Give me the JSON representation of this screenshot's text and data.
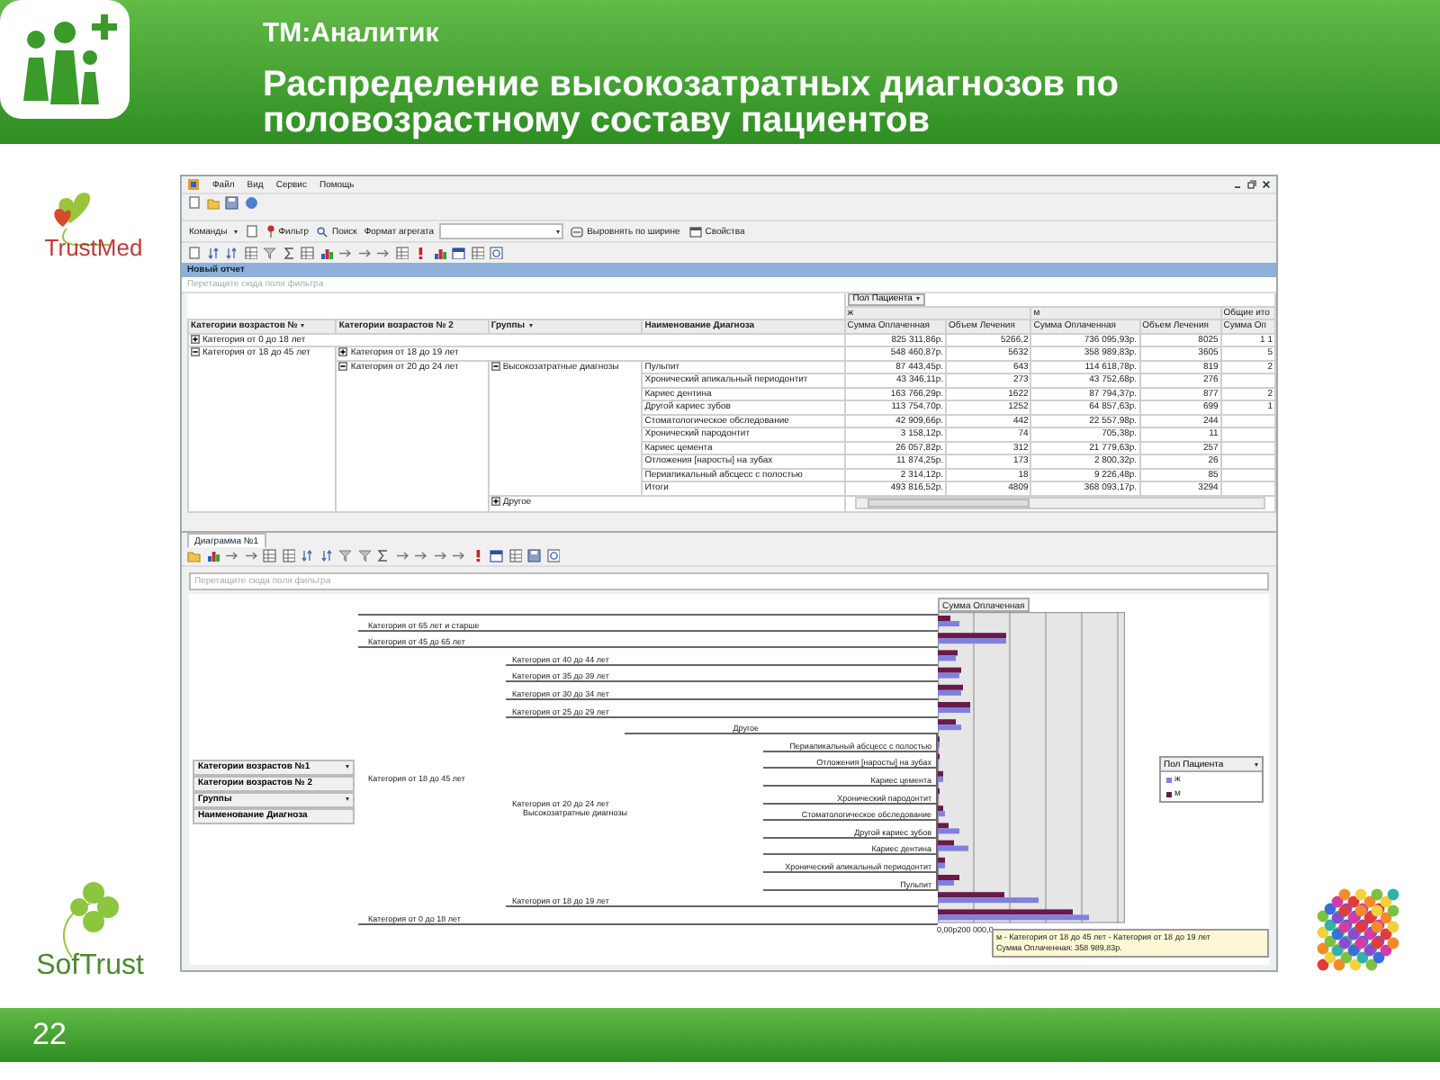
{
  "slide": {
    "subtitle": "ТМ:Аналитик",
    "title": "Распределение высокозатратных диагнозов по половозрастному составу пациентов",
    "page_number": "22"
  },
  "logos": {
    "top_left": "TrustMed",
    "bottom_left": "SofTrust"
  },
  "window": {
    "menu": [
      "Файл",
      "Вид",
      "Сервис",
      "Помощь"
    ],
    "toolbar": {
      "commands": "Команды",
      "filter": "Фильтр",
      "search": "Поиск",
      "aggregate_label": "Формат агрегата",
      "fit_width": "Выровнять по ширине",
      "properties": "Свойства"
    }
  },
  "pivot": {
    "title": "Новый отчет",
    "filter_placeholder": "Перетащите сюда поля фильтра",
    "column_field": "Пол Пациента",
    "column_groups": [
      {
        "label": "ж",
        "measures": [
          "Сумма Оплаченная",
          "Объем Лечения"
        ]
      },
      {
        "label": "м",
        "measures": [
          "Сумма Оплаченная",
          "Объем Лечения"
        ]
      },
      {
        "label": "Общие ито",
        "measures": [
          "Сумма Оп"
        ]
      }
    ],
    "row_fields": [
      {
        "label": "Категории возрастов №",
        "dropdown": true
      },
      {
        "label": "Категории возрастов № 2",
        "dropdown": false
      },
      {
        "label": "Группы",
        "dropdown": true
      },
      {
        "label": "Наименование Диагноза",
        "dropdown": false
      }
    ],
    "rows": [
      {
        "label": "Категория от 0 до 18 лет",
        "expanded": false,
        "values": [
          "825 311,86р.",
          "5266,2",
          "736 095,93р.",
          "8025"
        ],
        "total": "1 1"
      },
      {
        "label": "Категория от 18 до 45 лет",
        "expanded": true,
        "children": [
          {
            "label": "Категория от 18 до 19 лет",
            "expanded": false,
            "values": [
              "548 460,87р.",
              "5632",
              "358 989,83р.",
              "3605"
            ],
            "total": "5"
          },
          {
            "label": "Категория от 20 до 24 лет",
            "expanded": true,
            "children": [
              {
                "label": "Высокозатратные диагнозы",
                "expanded": true,
                "children": [
                  {
                    "label": "Пульпит",
                    "values": [
                      "87 443,45р.",
                      "643",
                      "114 618,78р.",
                      "819"
                    ],
                    "total": "2"
                  },
                  {
                    "label": "Хронический апикальный периодонтит",
                    "values": [
                      "43 346,11р.",
                      "273",
                      "43 752,68р.",
                      "276"
                    ]
                  },
                  {
                    "label": "Кариес дентина",
                    "values": [
                      "163 766,29р.",
                      "1622",
                      "87 794,37р.",
                      "877"
                    ],
                    "total": "2"
                  },
                  {
                    "label": "Другой кариес зубов",
                    "values": [
                      "113 754,70р.",
                      "1252",
                      "64 857,63р.",
                      "699"
                    ],
                    "total": "1"
                  },
                  {
                    "label": "Стоматологическое обследование",
                    "values": [
                      "42 909,66р.",
                      "442",
                      "22 557,98р.",
                      "244"
                    ]
                  },
                  {
                    "label": "Хронический пародонтит",
                    "values": [
                      "3 158,12р.",
                      "74",
                      "705,38р.",
                      "11"
                    ]
                  },
                  {
                    "label": "Кариес цемента",
                    "values": [
                      "26 057,82р.",
                      "312",
                      "21 779,63р.",
                      "257"
                    ]
                  },
                  {
                    "label": "Отложения [наросты] на зубах",
                    "values": [
                      "11 874,25р.",
                      "173",
                      "2 800,32р.",
                      "26"
                    ]
                  },
                  {
                    "label": "Периапикальный абсцесс с полостью",
                    "values": [
                      "2 314,12р.",
                      "18",
                      "9 226,48р.",
                      "85"
                    ]
                  },
                  {
                    "label": "Итоги",
                    "values": [
                      "493 816,52р.",
                      "4809",
                      "368 093,17р.",
                      "3294"
                    ]
                  }
                ]
              },
              {
                "label": "Другое",
                "expanded": false
              }
            ]
          }
        ]
      }
    ]
  },
  "chart": {
    "tab": {
      "label": "Диаграмма №1",
      "selected": true
    },
    "filter_placeholder": "Перетащите сюда поля фильтра",
    "fields": [
      {
        "label": "Категории возрастов №1",
        "dropdown": true
      },
      {
        "label": "Категории возрастов № 2",
        "dropdown": false
      },
      {
        "label": "Группы",
        "dropdown": true
      },
      {
        "label": "Наименование Диагноза",
        "dropdown": false
      }
    ],
    "measure": "Сумма Оплаченная",
    "axis_tree": [
      {
        "label": "Категория от 65 лет и старше"
      },
      {
        "label": "Категория от 45 до 65 лет"
      },
      {
        "label": "Категория от 18 до 45 лет",
        "children": [
          {
            "label": "Категория от 40 до 44 лет"
          },
          {
            "label": "Категория от 35 до 39 лет"
          },
          {
            "label": "Категория от 30 до 34 лет"
          },
          {
            "label": "Категория от 25 до 29 лет"
          },
          {
            "label": "Категория от 20 до 24 лет",
            "children": [
              {
                "label": "Другое"
              },
              {
                "label": "Высокозатратные диагнозы",
                "children": [
                  {
                    "label": "Периапикальный абсцесс с полостью"
                  },
                  {
                    "label": "Отложения [наросты] на зубах"
                  },
                  {
                    "label": "Кариес цемента"
                  },
                  {
                    "label": "Хронический пародонтит"
                  },
                  {
                    "label": "Стоматологическое обследование"
                  },
                  {
                    "label": "Другой кариес зубов"
                  },
                  {
                    "label": "Кариес дентина"
                  },
                  {
                    "label": "Хронический апикальный периодонтит"
                  },
                  {
                    "label": "Пульпит"
                  }
                ]
              }
            ]
          },
          {
            "label": "Категория от 18 до 19 лет"
          }
        ]
      },
      {
        "label": "Категория от 0 до 18 лет"
      }
    ],
    "axis_labels": [
      "0,00р",
      "200 000,0"
    ],
    "tooltip": [
      "м - Категория от 18 до 45 лет - Категория от 18 до 19 лет",
      "Сумма Оплаченная: 358 989,83р."
    ],
    "legend": {
      "title": "Пол Пациента",
      "items": [
        {
          "label": "ж",
          "color": "#8080e0"
        },
        {
          "label": "м",
          "color": "#6a1a4a"
        }
      ]
    }
  }
}
